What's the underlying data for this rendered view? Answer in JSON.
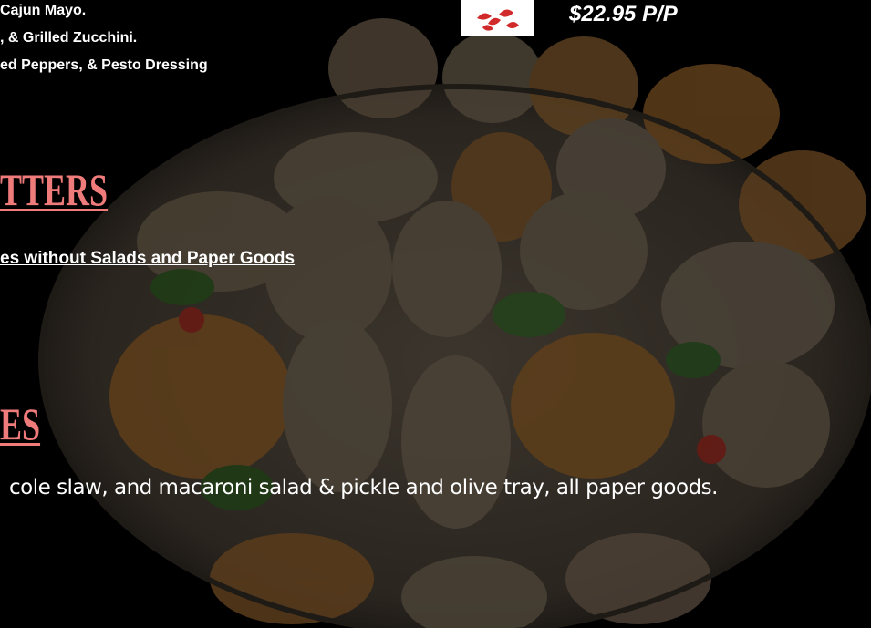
{
  "menu": {
    "lines": [
      "Cajun Mayo.",
      ", & Grilled Zucchini.",
      "ed Peppers, & Pesto Dressing"
    ],
    "price": "$22.95 P/P"
  },
  "sections": {
    "platters_heading": "TTERS",
    "platters_note": "es without Salads and Paper Goods",
    "packages_heading": "ES",
    "packages_description": "cole slaw, and macaroni salad & pickle and olive tray, all paper goods."
  },
  "colors": {
    "heading": "#f07b7b",
    "text": "#ffffff",
    "background": "#000000",
    "logo_red": "#d12a2a"
  },
  "icons": {
    "logo": "red-leaf-logo"
  }
}
